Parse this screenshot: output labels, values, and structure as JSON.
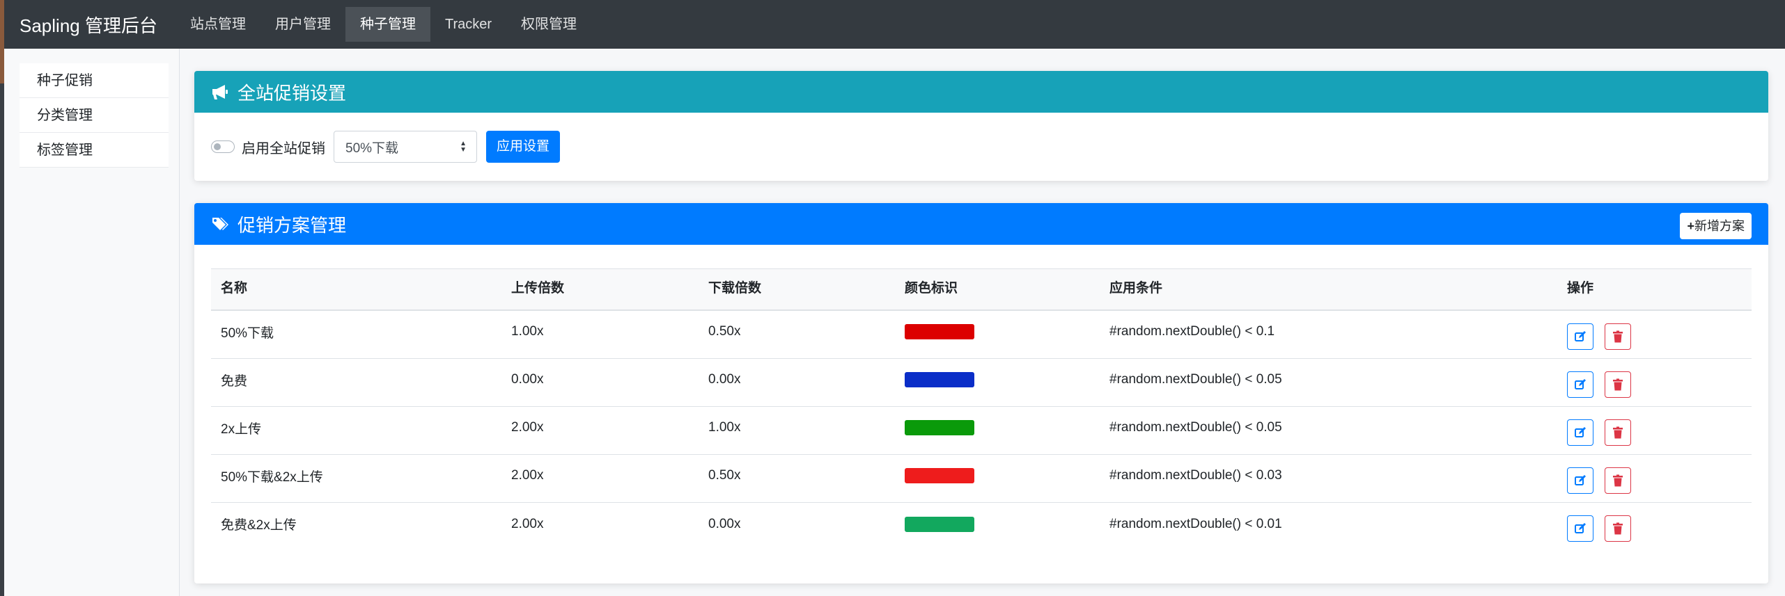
{
  "navbar": {
    "brand": "Sapling 管理后台",
    "items": [
      {
        "label": "站点管理",
        "active": false
      },
      {
        "label": "用户管理",
        "active": false
      },
      {
        "label": "种子管理",
        "active": true
      },
      {
        "label": "Tracker",
        "active": false
      },
      {
        "label": "权限管理",
        "active": false
      }
    ]
  },
  "sidebar": {
    "items": [
      {
        "label": "种子促销"
      },
      {
        "label": "分类管理"
      },
      {
        "label": "标签管理"
      }
    ]
  },
  "global_promo": {
    "title": "全站促销设置",
    "icon": "bullhorn-icon",
    "toggle_label": "启用全站促销",
    "toggle_on": false,
    "select_value": "50%下载",
    "apply_label": "应用设置"
  },
  "schemes": {
    "title": "促销方案管理",
    "icon": "tags-icon",
    "add_label": "新增方案",
    "columns": {
      "name": "名称",
      "upload": "上传倍数",
      "download": "下载倍数",
      "color": "颜色标识",
      "condition": "应用条件",
      "actions": "操作"
    },
    "rows": [
      {
        "name": "50%下载",
        "upload": "1.00x",
        "download": "0.50x",
        "color": "#dc0000",
        "condition": "#random.nextDouble() < 0.1"
      },
      {
        "name": "免费",
        "upload": "0.00x",
        "download": "0.00x",
        "color": "#0a2ec8",
        "condition": "#random.nextDouble() < 0.05"
      },
      {
        "name": "2x上传",
        "upload": "2.00x",
        "download": "1.00x",
        "color": "#0a9a0a",
        "condition": "#random.nextDouble() < 0.05"
      },
      {
        "name": "50%下载&2x上传",
        "upload": "2.00x",
        "download": "0.50x",
        "color": "#ee1c1c",
        "condition": "#random.nextDouble() < 0.03"
      },
      {
        "name": "免费&2x上传",
        "upload": "2.00x",
        "download": "0.00x",
        "color": "#12a85e",
        "condition": "#random.nextDouble() < 0.01"
      }
    ]
  },
  "colors": {
    "navbar": "#343a40",
    "teal_header": "#17a2b8",
    "blue_header": "#007bff",
    "primary": "#007bff",
    "danger": "#dc3545"
  }
}
